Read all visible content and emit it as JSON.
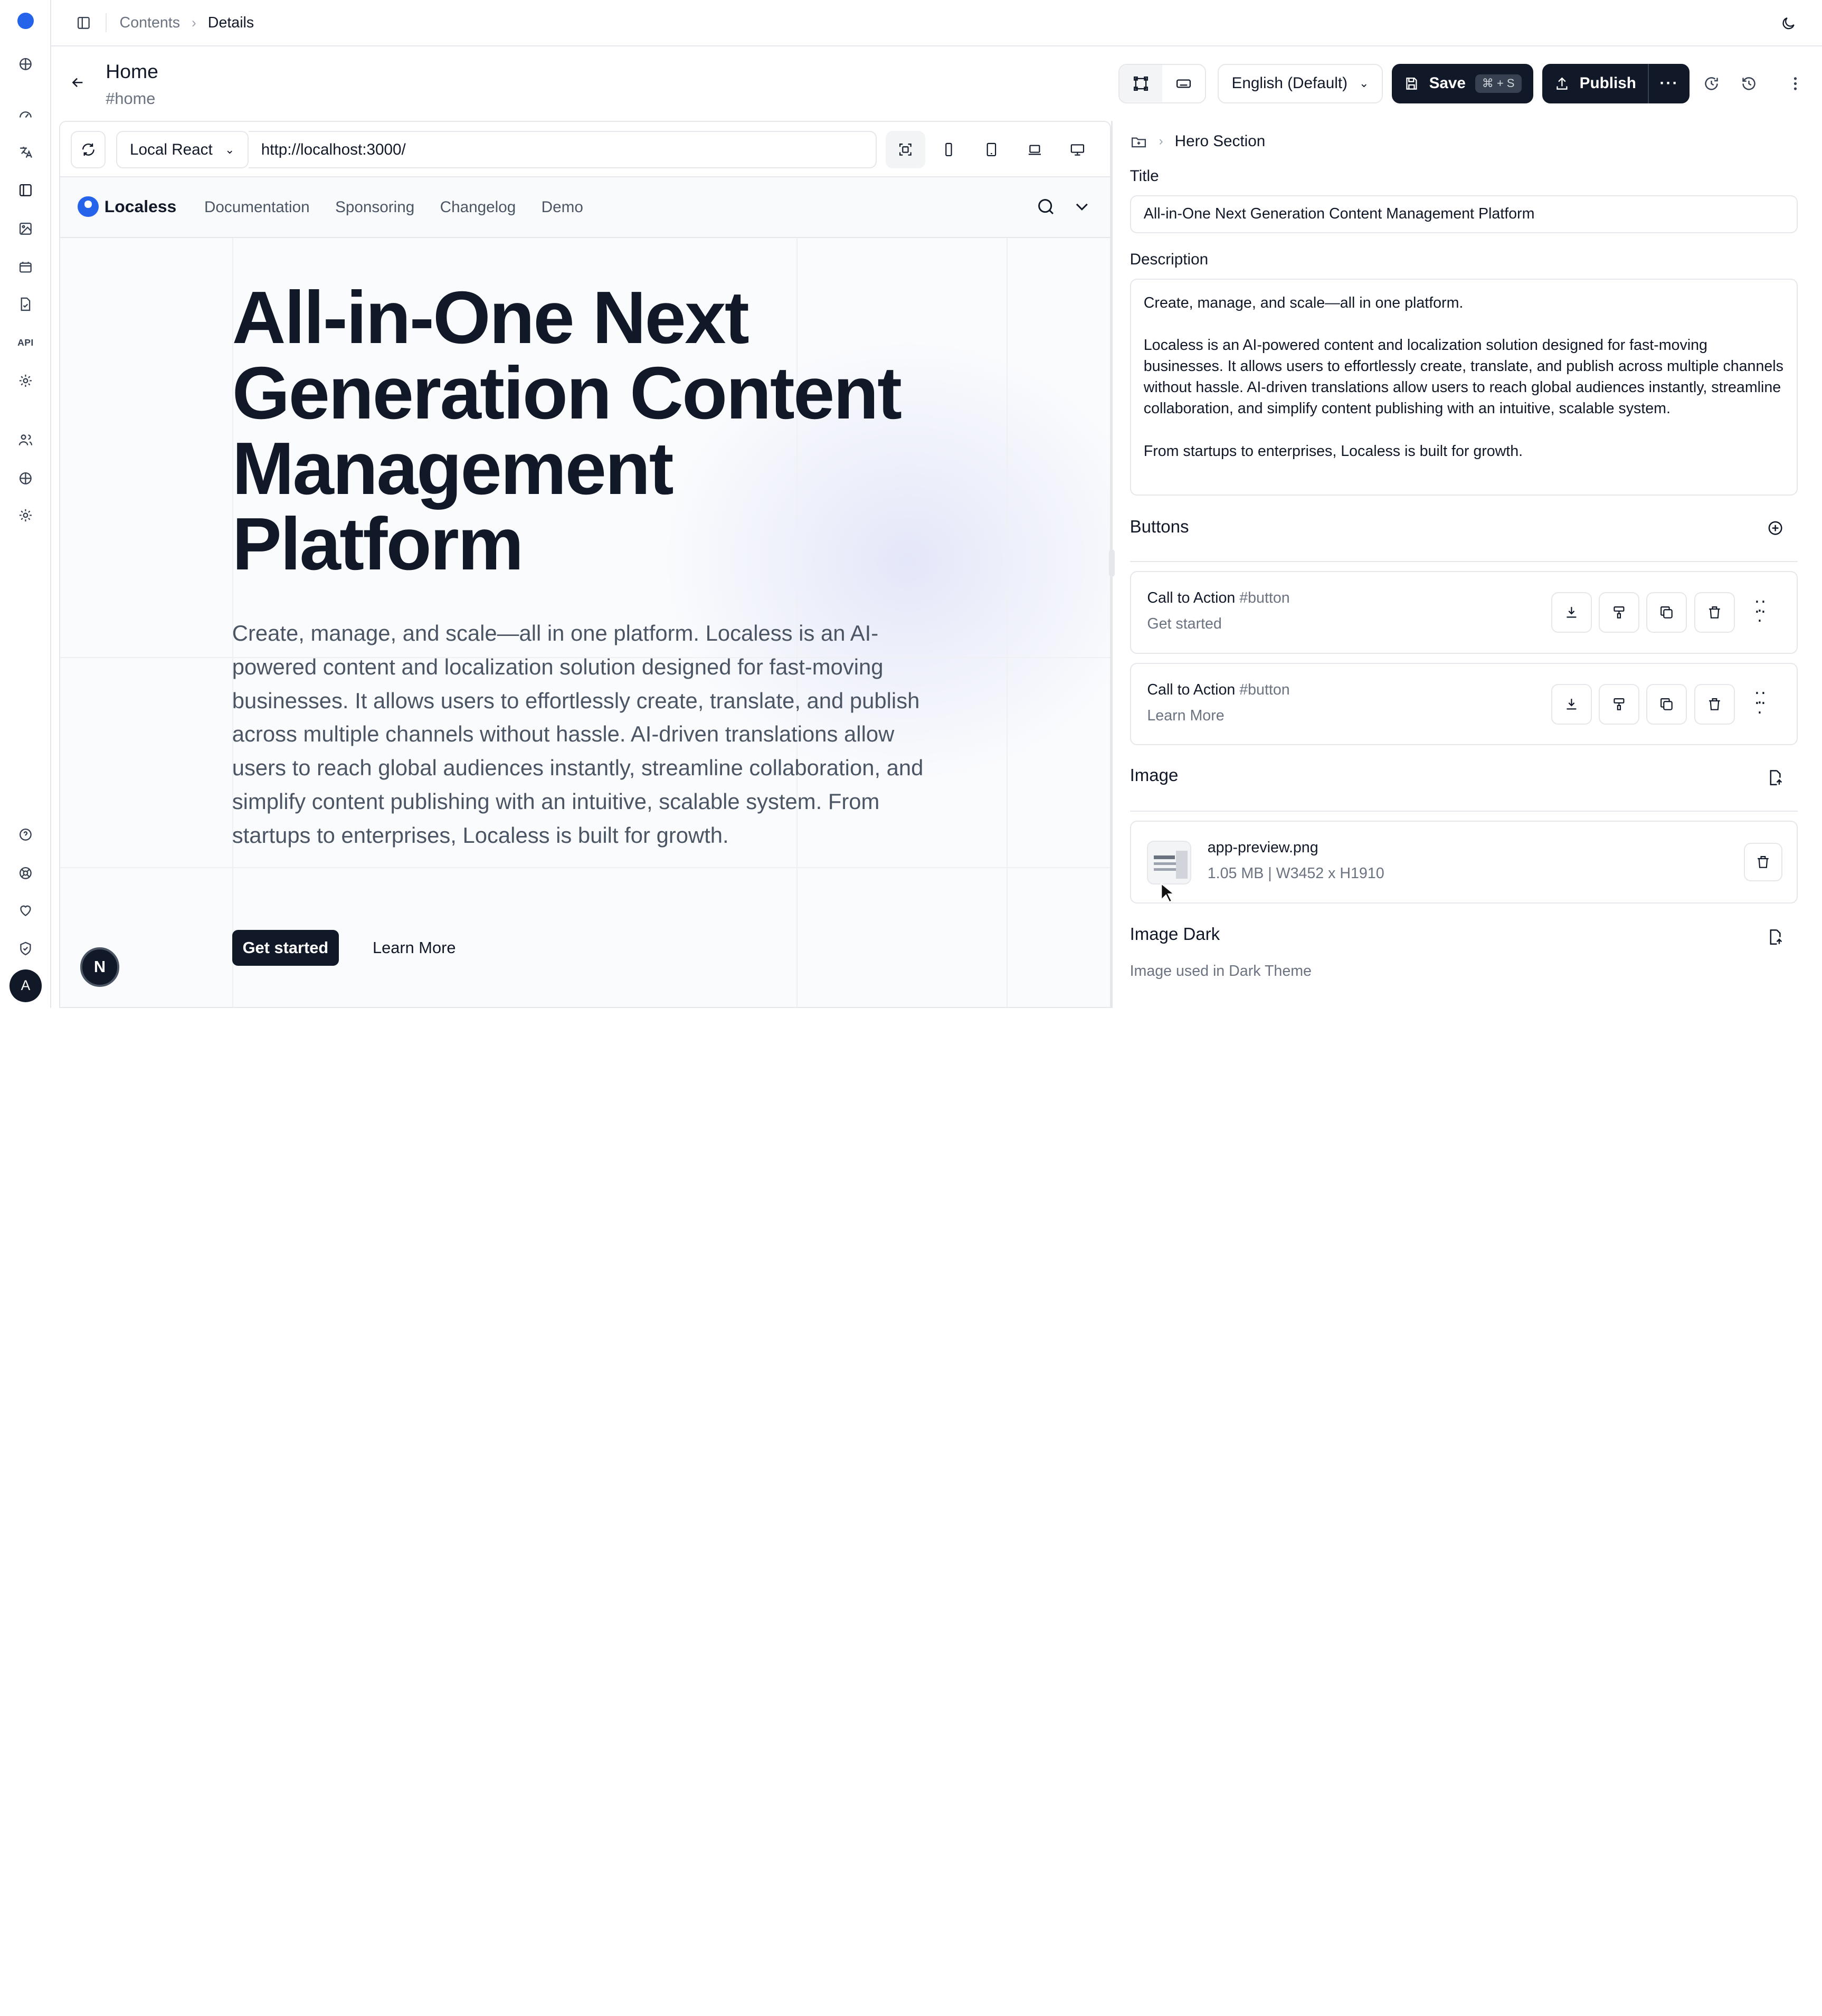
{
  "breadcrumb": {
    "root": "Contents",
    "current": "Details"
  },
  "page": {
    "title": "Home",
    "slug": "#home"
  },
  "header_actions": {
    "language": "English (Default)",
    "save_label": "Save",
    "save_shortcut": "⌘ + S",
    "publish_label": "Publish",
    "more_glyph": "···"
  },
  "preview": {
    "framework": "Local React",
    "url": "http://localhost:3000/",
    "devices": [
      "fit-icon",
      "phone-icon",
      "tablet-icon",
      "laptop-icon",
      "desktop-icon"
    ],
    "site": {
      "brand": "Localess",
      "nav": [
        "Documentation",
        "Sponsoring",
        "Changelog",
        "Demo"
      ],
      "hero_title": "All-in-One Next Generation Content Management Platform",
      "hero_description": "Create, manage, and scale—all in one platform. Localess is an AI-powered content and localization solution designed for fast-moving businesses. It allows users to effortlessly create, translate, and publish across multiple channels without hassle. AI-driven translations allow users to reach global audiences instantly, streamline collaboration, and simplify content publishing with an intuitive, scalable system. From startups to enterprises, Localess is built for growth.",
      "cta_primary": "Get started",
      "cta_secondary": "Learn More",
      "badge": "N"
    }
  },
  "panel": {
    "crumb": "Hero Section",
    "title_label": "Title",
    "title_value": "All-in-One Next Generation Content Management Platform",
    "description_label": "Description",
    "description_value": "Create, manage, and scale—all in one platform.\n\nLocaless is an AI-powered content and localization solution designed for fast-moving businesses. It allows users to effortlessly create, translate, and publish across multiple channels without hassle. AI-driven translations allow users to reach global audiences instantly, streamline collaboration, and simplify content publishing with an intuitive, scalable system.\n\nFrom startups to enterprises, Localess is built for growth.",
    "buttons_heading": "Buttons",
    "buttons": [
      {
        "name": "Call to Action",
        "tag": "#button",
        "value": "Get started"
      },
      {
        "name": "Call to Action",
        "tag": "#button",
        "value": "Learn More"
      }
    ],
    "image_heading": "Image",
    "image": {
      "filename": "app-preview.png",
      "meta": "1.05 MB | W3452 x H1910"
    },
    "image_dark_heading": "Image Dark",
    "image_dark_hint": "Image used in Dark Theme"
  },
  "user": {
    "initial": "A"
  },
  "colors": {
    "accent": "#2563eb",
    "dark": "#111827",
    "muted": "#6b7280",
    "border": "#e5e7eb"
  }
}
